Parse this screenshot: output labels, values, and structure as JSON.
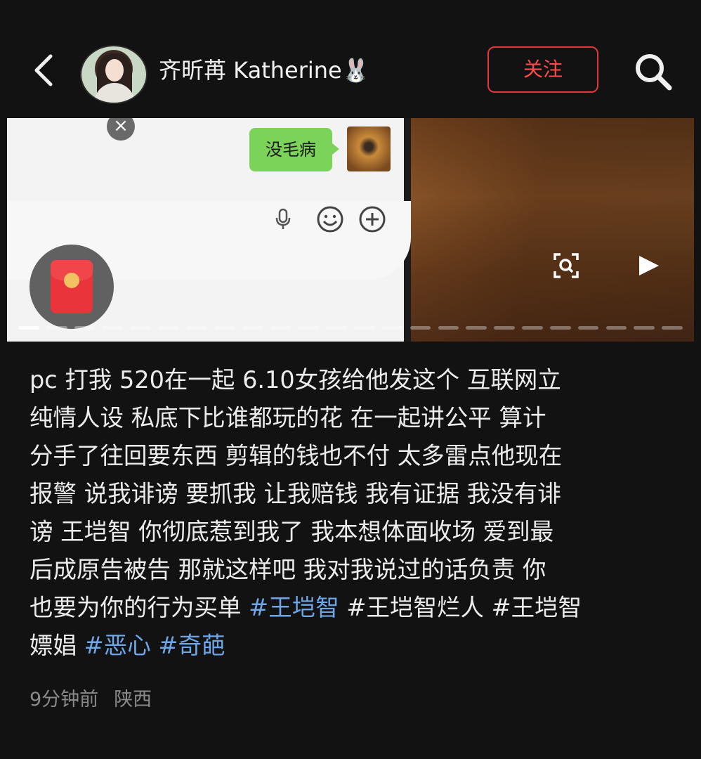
{
  "header": {
    "username": "齐昕苒 Katherine🐰",
    "follow_label": "关注"
  },
  "media": {
    "chat_bubble_text": "没毛病",
    "close_symbol": "×",
    "segments_total": 24,
    "segments_active": 1
  },
  "post": {
    "lines": [
      [
        {
          "t": "pc 打我 520在一起 6.10女孩给他发这个 互联网立"
        }
      ],
      [
        {
          "t": "纯情人设 私底下比谁都玩的花 在一起讲公平 算计"
        }
      ],
      [
        {
          "t": "分手了往回要东西 剪辑的钱也不付 太多雷点他现在"
        }
      ],
      [
        {
          "t": "报警 说我诽谤 要抓我 让我赔钱 我有证据 我没有诽"
        }
      ],
      [
        {
          "t": "谤 王垲智 你彻底惹到我了 我本想体面收场 爱到最"
        }
      ],
      [
        {
          "t": "后成原告被告 那就这样吧 我对我说过的话负责 你"
        }
      ],
      [
        {
          "t": "也要为你的行为买单 "
        },
        {
          "t": "#王垲智",
          "tag": true
        },
        {
          "t": " #王垲智烂人 #王垲智"
        }
      ],
      [
        {
          "t": "嫖娼 "
        },
        {
          "t": "#恶心",
          "tag": true
        },
        {
          "t": " "
        },
        {
          "t": "#奇葩",
          "tag": true
        }
      ]
    ]
  },
  "meta": {
    "time": "9分钟前",
    "location": "陕西"
  },
  "colors": {
    "background": "#121212",
    "follow_red": "#e4373a",
    "hashtag_blue": "#6ea6e8",
    "meta_gray": "#8a8a8a"
  },
  "icons": [
    "back-arrow-icon",
    "search-icon",
    "red-packet-icon",
    "close-icon",
    "mic-icon",
    "emoji-icon",
    "plus-icon",
    "scan-icon",
    "play-icon"
  ]
}
